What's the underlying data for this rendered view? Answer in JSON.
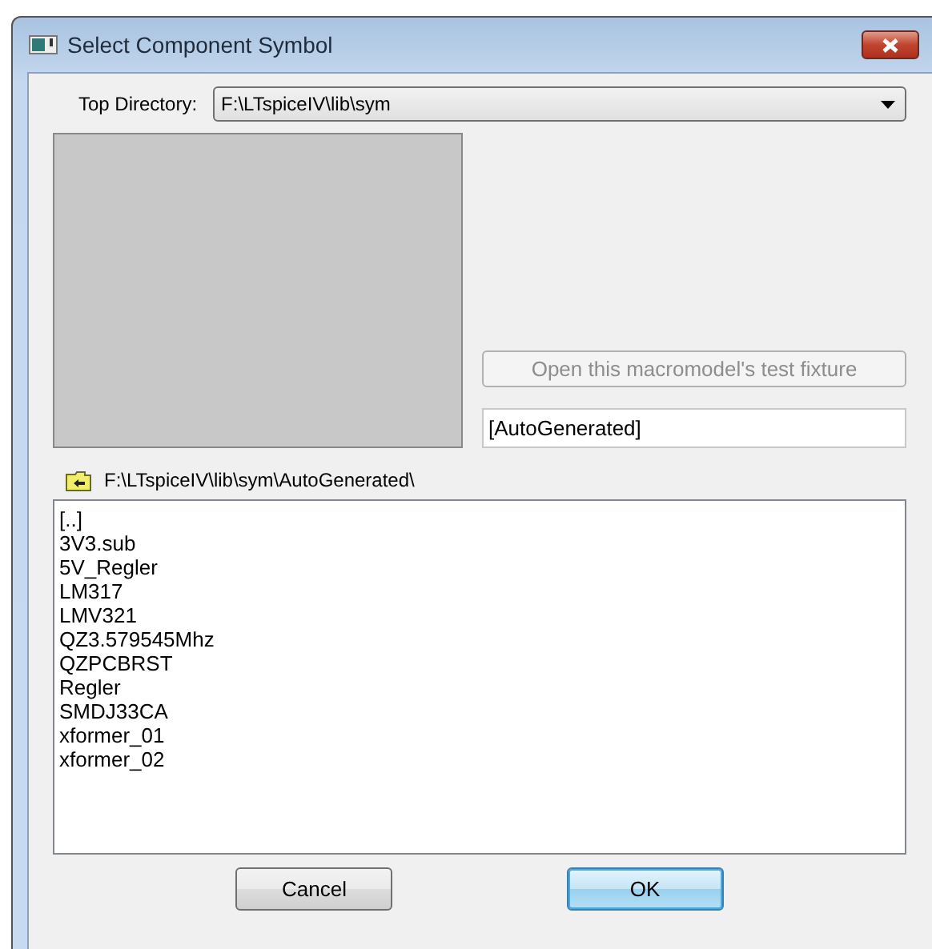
{
  "window": {
    "title": "Select Component Symbol"
  },
  "top_directory": {
    "label": "Top Directory:",
    "value": "F:\\LTspiceIV\\lib\\sym"
  },
  "test_fixture_button": {
    "label": "Open this macromodel's test fixture",
    "disabled": true
  },
  "name_field": {
    "value": "[AutoGenerated]"
  },
  "current_path": "F:\\LTspiceIV\\lib\\sym\\AutoGenerated\\",
  "files": [
    "[..]",
    "3V3.sub",
    "5V_Regler",
    "LM317",
    "LMV321",
    "QZ3.579545Mhz",
    "QZPCBRST",
    "Regler",
    "SMDJ33CA",
    "xformer_01",
    "xformer_02"
  ],
  "buttons": [
    {
      "label": "Cancel",
      "default": false
    },
    {
      "label": "OK",
      "default": true
    }
  ]
}
